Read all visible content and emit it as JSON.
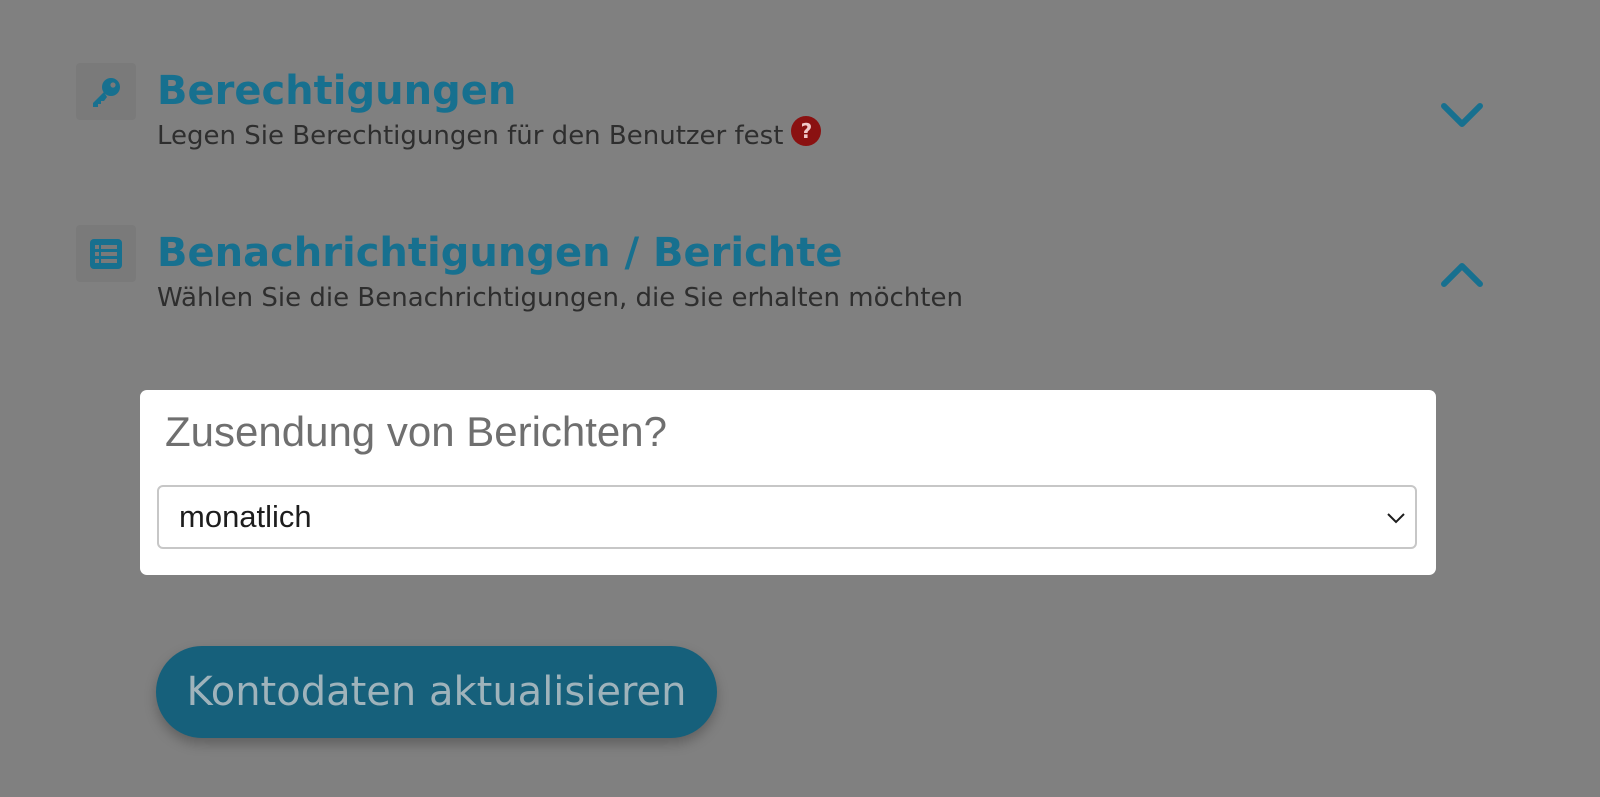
{
  "sections": [
    {
      "title": "Berechtigungen",
      "subtitle": "Legen Sie Berechtigungen für den Benutzer fest",
      "icon": "key-icon",
      "help": "?",
      "expanded": false
    },
    {
      "title": "Benachrichtigungen / Berichte",
      "subtitle": "Wählen Sie die Benachrichtigungen, die Sie erhalten möchten",
      "icon": "list-icon",
      "expanded": true
    }
  ],
  "reports": {
    "label": "Zusendung von Berichten?",
    "selected": "monatlich"
  },
  "submit": {
    "label": "Kontodaten aktualisieren"
  },
  "colors": {
    "accent": "#17708f",
    "button": "#16607b",
    "help": "#8a1111",
    "overlay": "#808080"
  }
}
